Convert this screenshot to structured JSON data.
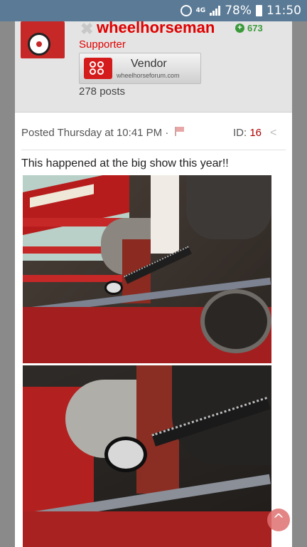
{
  "status_bar": {
    "network": "4G",
    "battery": "78%",
    "time": "11:50"
  },
  "post": {
    "author": {
      "username": "wheelhorseman",
      "reputation": "673",
      "title": "Supporter",
      "badge_label": "Vendor",
      "badge_site": "wheelhorseforum.com",
      "post_count": "278 posts"
    },
    "posted": "Posted Thursday at 10:41 PM",
    "separator": "·",
    "id_label": "ID:",
    "id_value": "16",
    "body": "This happened at the big show this year!!",
    "images": [
      {
        "subject": "black snake coiled around red tractor engine belt"
      },
      {
        "subject": "close-up of black snake head near engine pulley"
      }
    ]
  },
  "colors": {
    "status_bar": "#5a7a96",
    "username": "#e00000",
    "reputation": "#3a9a3a",
    "id_value": "#b00000"
  },
  "icons": [
    "alarm-icon",
    "signal-icon",
    "battery-icon",
    "ignore-user-icon",
    "plus-icon",
    "report-flag-icon",
    "share-icon",
    "scroll-top-icon"
  ]
}
